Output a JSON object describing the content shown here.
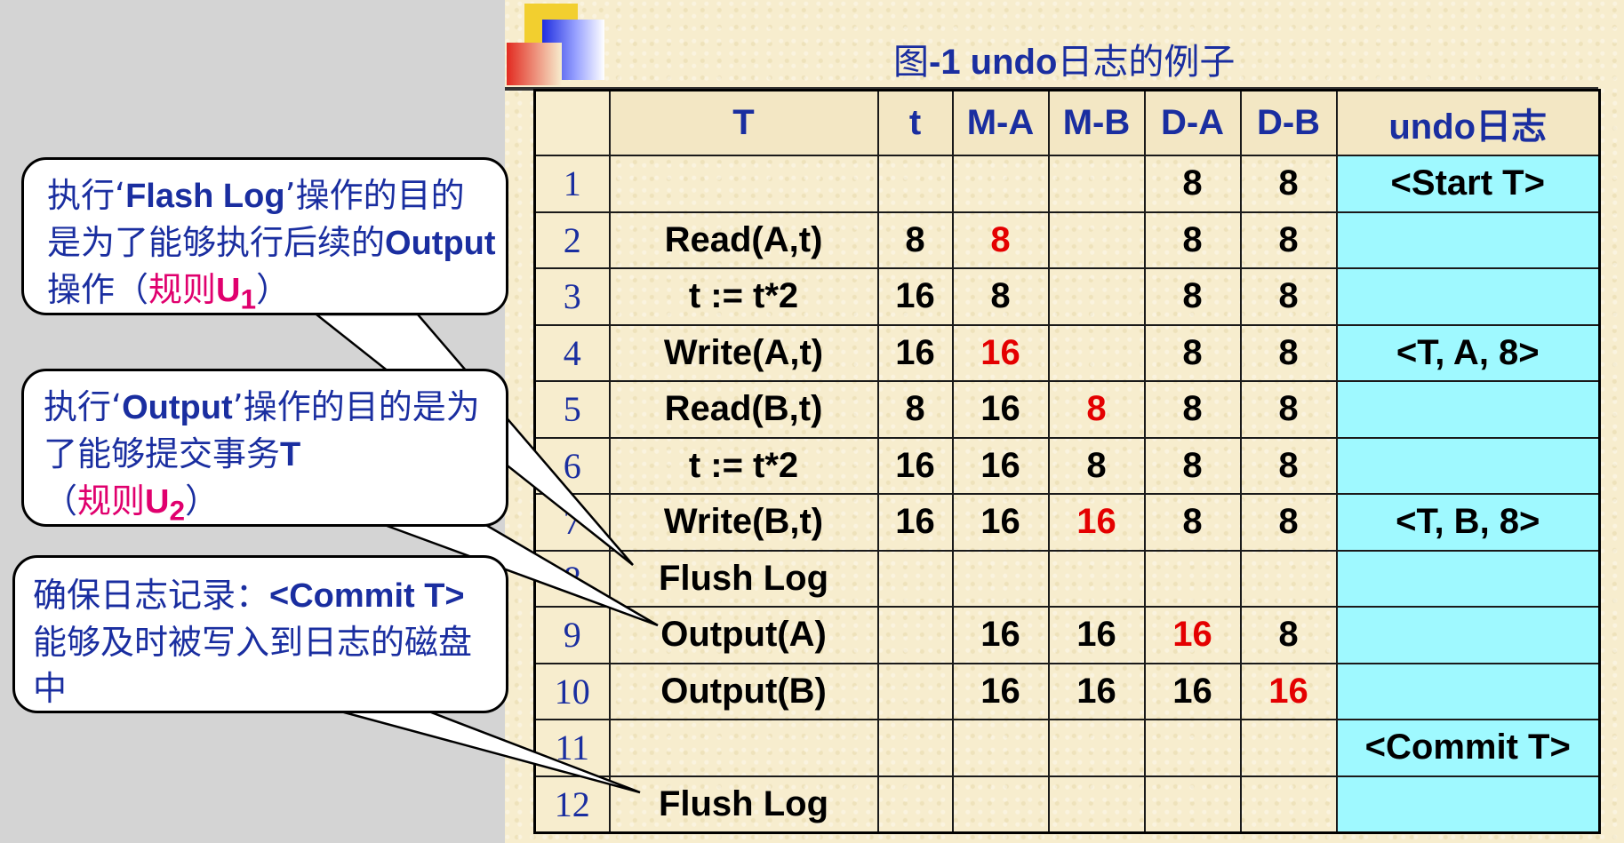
{
  "title": {
    "prefix": "图",
    "bold": "-1  undo",
    "suffix": "日志的例子"
  },
  "table": {
    "headers": [
      "",
      "T",
      "t",
      "M-A",
      "M-B",
      "D-A",
      "D-B",
      "undo日志"
    ],
    "rows": [
      {
        "num": "1",
        "T": "",
        "t": "",
        "MA": "",
        "MB": "",
        "DA": "8",
        "DB": "8",
        "undo": "<Start T>"
      },
      {
        "num": "2",
        "T": "Read(A,t)",
        "t": "8",
        "MA": "8",
        "MB": "",
        "DA": "8",
        "DB": "8",
        "undo": ""
      },
      {
        "num": "3",
        "T": "t := t*2",
        "t": "16",
        "MA": "8",
        "MB": "",
        "DA": "8",
        "DB": "8",
        "undo": ""
      },
      {
        "num": "4",
        "T": "Write(A,t)",
        "t": "16",
        "MA": "16",
        "MB": "",
        "DA": "8",
        "DB": "8",
        "undo": "<T, A, 8>"
      },
      {
        "num": "5",
        "T": "Read(B,t)",
        "t": "8",
        "MA": "16",
        "MB": "8",
        "DA": "8",
        "DB": "8",
        "undo": ""
      },
      {
        "num": "6",
        "T": "t := t*2",
        "t": "16",
        "MA": "16",
        "MB": "8",
        "DA": "8",
        "DB": "8",
        "undo": ""
      },
      {
        "num": "7",
        "T": "Write(B,t)",
        "t": "16",
        "MA": "16",
        "MB": "16",
        "DA": "8",
        "DB": "8",
        "undo": "<T, B, 8>"
      },
      {
        "num": "8",
        "T": "Flush Log",
        "t": "",
        "MA": "",
        "MB": "",
        "DA": "",
        "DB": "",
        "undo": ""
      },
      {
        "num": "9",
        "T": "Output(A)",
        "t": "",
        "MA": "16",
        "MB": "16",
        "DA": "16",
        "DB": "8",
        "undo": ""
      },
      {
        "num": "10",
        "T": "Output(B)",
        "t": "",
        "MA": "16",
        "MB": "16",
        "DA": "16",
        "DB": "16",
        "undo": ""
      },
      {
        "num": "11",
        "T": "",
        "t": "",
        "MA": "",
        "MB": "",
        "DA": "",
        "DB": "",
        "undo": "<Commit T>"
      },
      {
        "num": "12",
        "T": "Flush Log",
        "t": "",
        "MA": "",
        "MB": "",
        "DA": "",
        "DB": "",
        "undo": ""
      }
    ]
  },
  "callouts": {
    "flash": {
      "p1": "执行‘",
      "b1": "Flash Log",
      "p2": "’操作的目的是为了能够执行后续的",
      "b2": "Output",
      "p3": "操作（",
      "pink": "规则",
      "rule": "U",
      "sub": "1",
      "end": "）"
    },
    "output": {
      "p1": "执行‘",
      "b1": "Output",
      "p2": "’操作的目的是为了能够提交事务",
      "b2": "T",
      "p3": "（",
      "pink": "规则",
      "rule": "U",
      "sub": "2",
      "end": "）"
    },
    "commit": {
      "p1": "确保日志记录：",
      "b1": "<Commit T>",
      "p2": "能够及时被写入到日志的磁盘中"
    }
  },
  "colors": {
    "blue_text": "#1a2ea0",
    "red_value": "#e40000",
    "undo_cell": "#9ff9ff",
    "rule_pink": "#e0006e"
  }
}
